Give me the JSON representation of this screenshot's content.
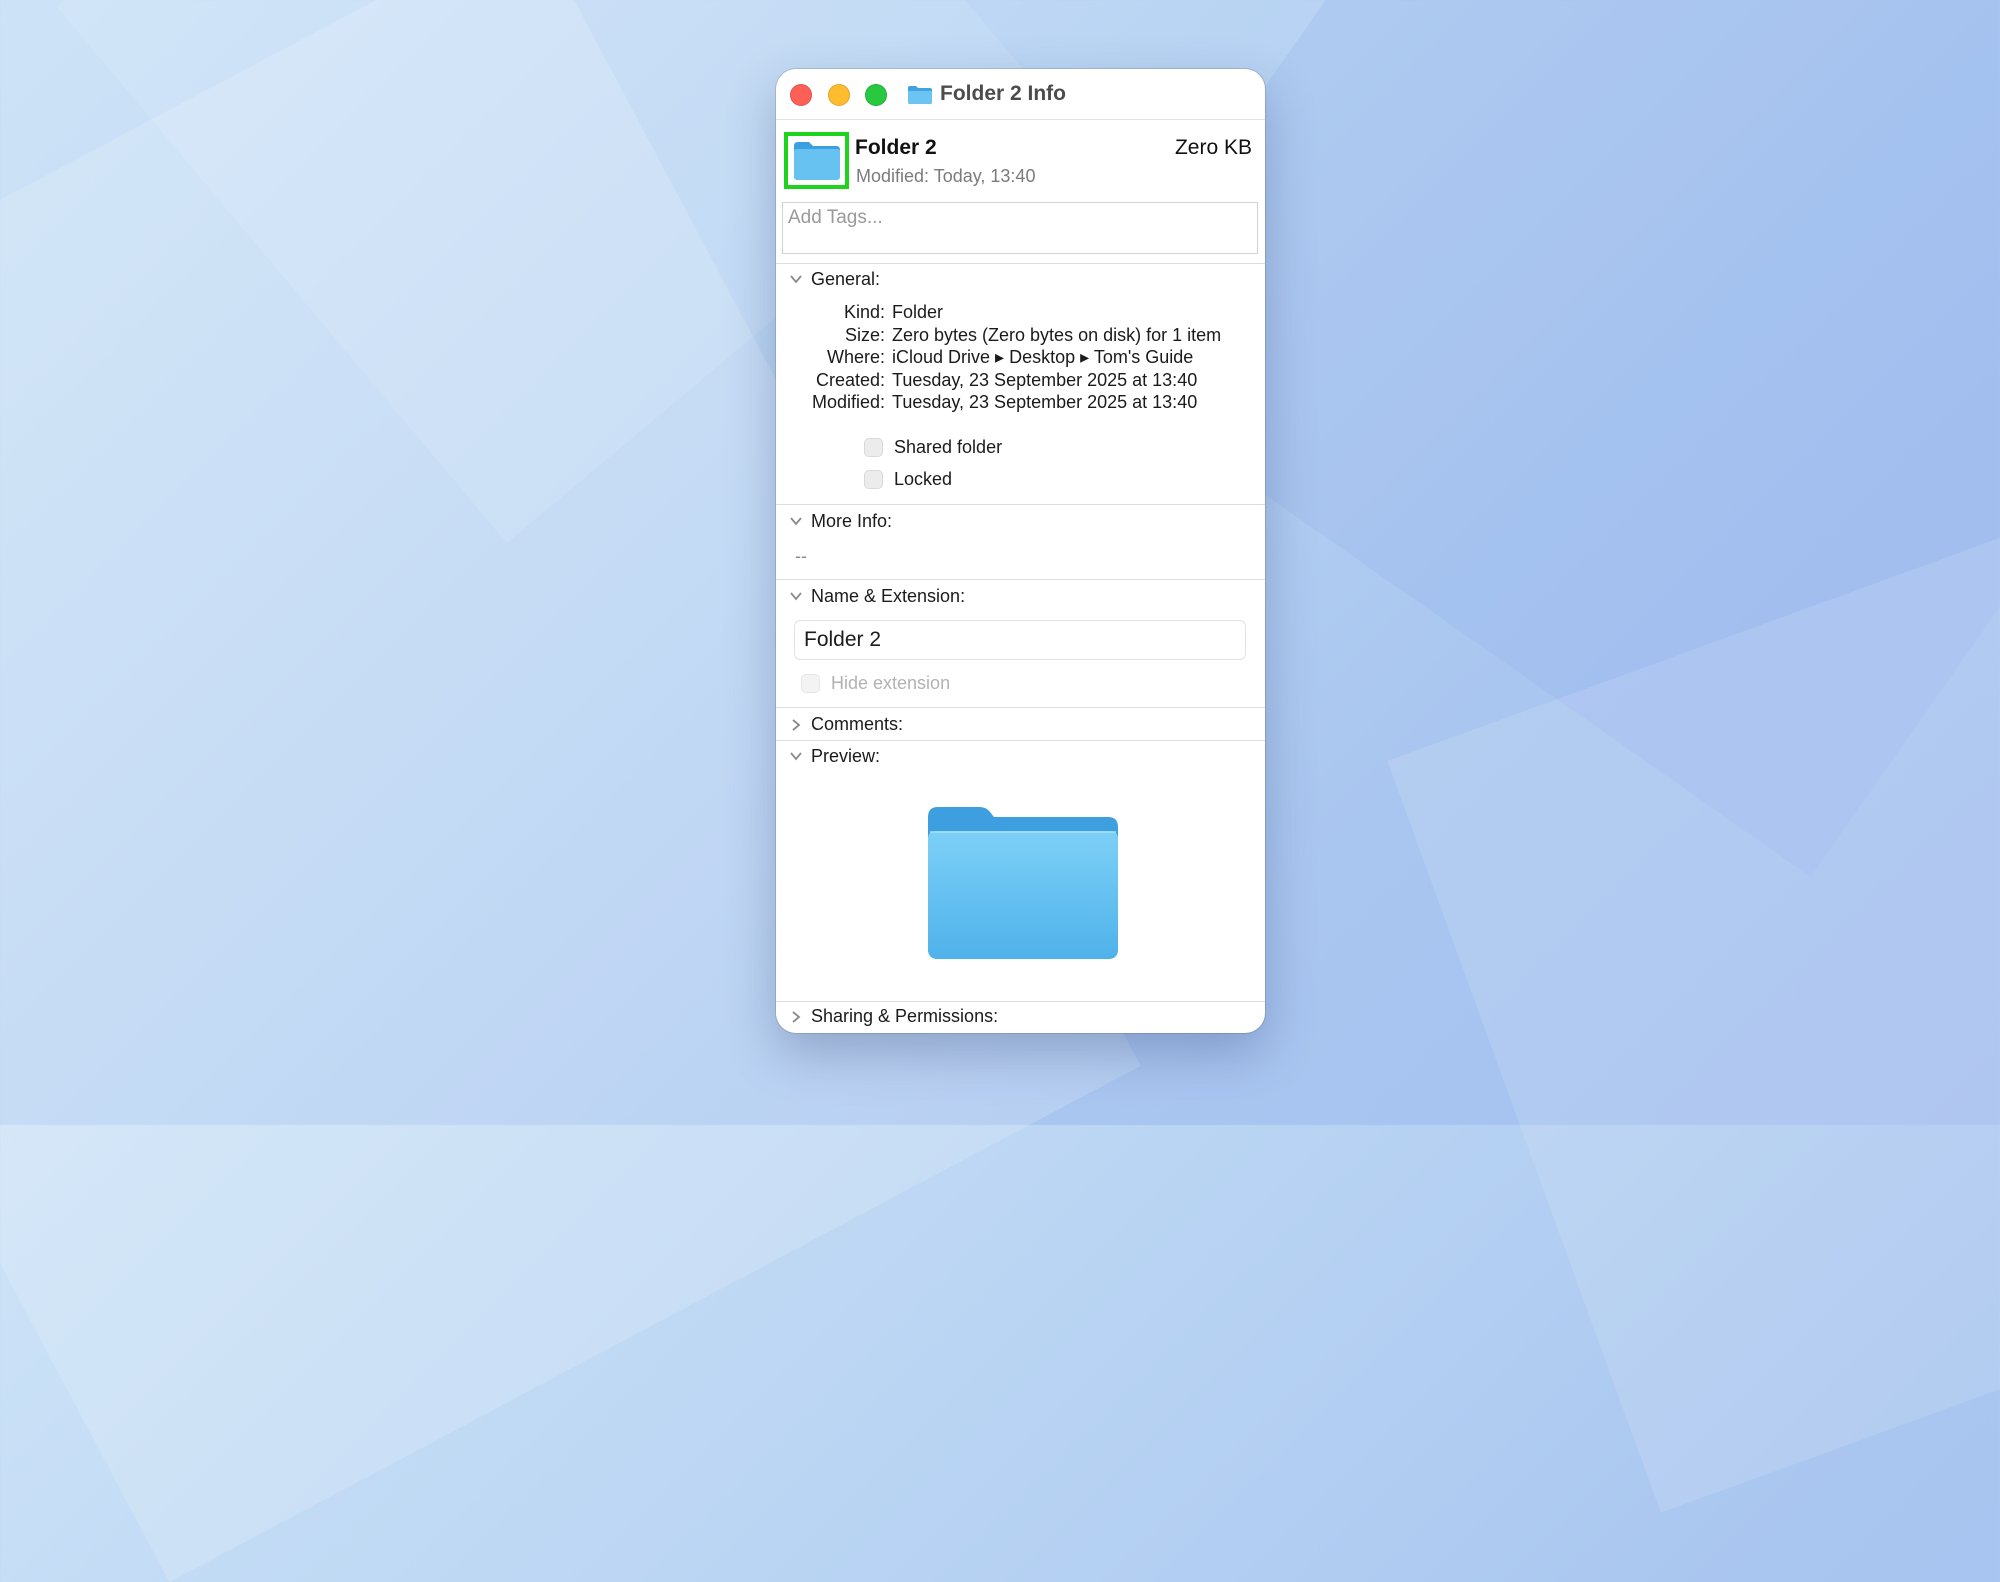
{
  "window": {
    "title": "Folder 2 Info",
    "title_icon": "folder-icon"
  },
  "header": {
    "name": "Folder 2",
    "size": "Zero KB",
    "modified": "Modified:  Today, 13:40",
    "icon": "folder-icon"
  },
  "tags": {
    "placeholder": "Add Tags..."
  },
  "general": {
    "label": "General:",
    "rows": [
      {
        "key": "Kind:",
        "value": "Folder"
      },
      {
        "key": "Size:",
        "value": "Zero bytes (Zero bytes on disk) for 1 item"
      },
      {
        "key": "Where:",
        "value": "iCloud Drive ▸ Desktop ▸ Tom's Guide"
      },
      {
        "key": "Created:",
        "value": "Tuesday, 23 September 2025 at 13:40"
      },
      {
        "key": "Modified:",
        "value": "Tuesday, 23 September 2025 at 13:40"
      }
    ],
    "shared_folder": {
      "label": "Shared folder",
      "checked": false
    },
    "locked": {
      "label": "Locked",
      "checked": false
    }
  },
  "more_info": {
    "label": "More Info:",
    "value": "--"
  },
  "name_extension": {
    "label": "Name & Extension:",
    "value": "Folder 2",
    "hide_extension": {
      "label": "Hide extension",
      "checked": false,
      "enabled": false
    }
  },
  "comments": {
    "label": "Comments:",
    "expanded": false
  },
  "preview": {
    "label": "Preview:",
    "expanded": true,
    "icon": "folder-icon"
  },
  "sharing": {
    "label": "Sharing & Permissions:",
    "expanded": false
  },
  "colors": {
    "folder_blue": "#5ab9ee",
    "highlight_green": "#1dd31d",
    "close_red": "#fe5f57",
    "minimize_yellow": "#febc2e",
    "zoom_green": "#28c840"
  }
}
